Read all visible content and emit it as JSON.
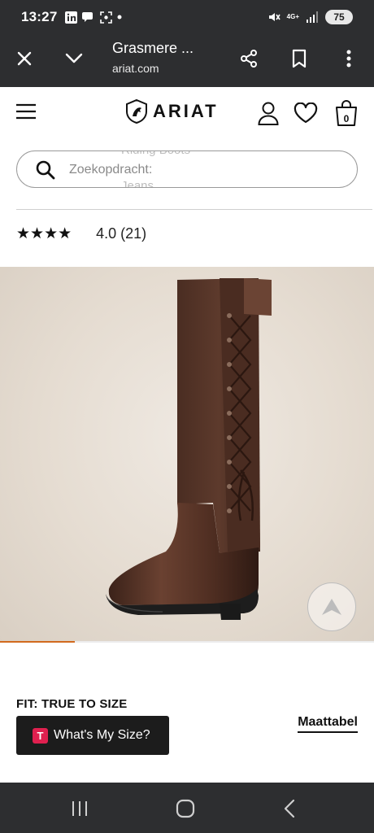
{
  "status_bar": {
    "time": "13:27",
    "network_label": "4G+",
    "battery": "75"
  },
  "browser": {
    "title": "Grasmere ...",
    "url": "ariat.com"
  },
  "header": {
    "brand": "ARIAT",
    "cart_count": "0"
  },
  "search": {
    "placeholder": "Zoekopdracht:",
    "suggestion_prev": "Riding Boots",
    "suggestion_next": "Jeans"
  },
  "rating": {
    "stars": "★★★★",
    "value_text": "4.0 (21)",
    "value": 4.0,
    "count": 21
  },
  "gallery": {
    "progress": 0.2
  },
  "fit": {
    "label": "FIT: TRUE TO SIZE",
    "size_button": "What's My Size?",
    "size_badge": "T",
    "size_chart_link": "Maattabel"
  },
  "colors": {
    "status_bar_bg": "#2d2e30",
    "accent_orange": "#d26a1e",
    "badge_red": "#e0204f"
  }
}
